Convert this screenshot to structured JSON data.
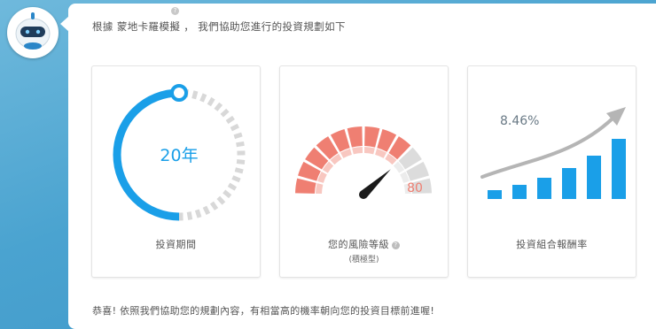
{
  "intro_text": "根據 蒙地卡羅模擬 ， 我們協助您進行的投資規劃如下",
  "intro_help_icon": "question-mark-icon",
  "cards": {
    "period": {
      "value_text": "20年",
      "label": "投資期間",
      "progress_fraction": 0.5,
      "accent_color": "#1a9fe8",
      "track_color": "#d8d8d8"
    },
    "risk": {
      "value_text": "80",
      "label": "您的風險等級",
      "sub_label": "(積極型)",
      "info_icon": "question-mark-icon",
      "gauge_level": 80,
      "active_segments": 9,
      "total_segments": 12,
      "active_color": "#ef7f72",
      "inactive_color": "#dcdcdc"
    },
    "return": {
      "value_text": "8.46%",
      "label": "投資組合報酬率",
      "bar_color": "#1a9fe8",
      "trend_color": "#b5b5b5"
    }
  },
  "footer_text": "恭喜! 依照我們協助您的規劃內容，有相當高的機率朝向您的投資目標前進喔!",
  "colors": {
    "background": "#4aa3d0",
    "panel": "#ffffff",
    "accent_blue": "#1a9fe8",
    "risk_red": "#ef7f72"
  }
}
